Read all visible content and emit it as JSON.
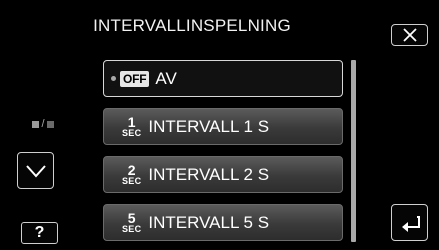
{
  "header": {
    "title": "INTERVALLINSPELNING"
  },
  "controls": {
    "close_icon": "close-x-icon",
    "page_indicator_glyphs": [
      "■",
      "/",
      "■"
    ],
    "down_icon": "chevron-down-icon",
    "help_label": "?",
    "back_icon": "return-arrow-icon"
  },
  "menu": {
    "items": [
      {
        "badge": "OFF",
        "label": "AV",
        "selected": true
      },
      {
        "num": "1",
        "unit": "SEC",
        "label": "INTERVALL 1 S"
      },
      {
        "num": "2",
        "unit": "SEC",
        "label": "INTERVALL 2 S"
      },
      {
        "num": "5",
        "unit": "SEC",
        "label": "INTERVALL 5 S"
      }
    ]
  }
}
